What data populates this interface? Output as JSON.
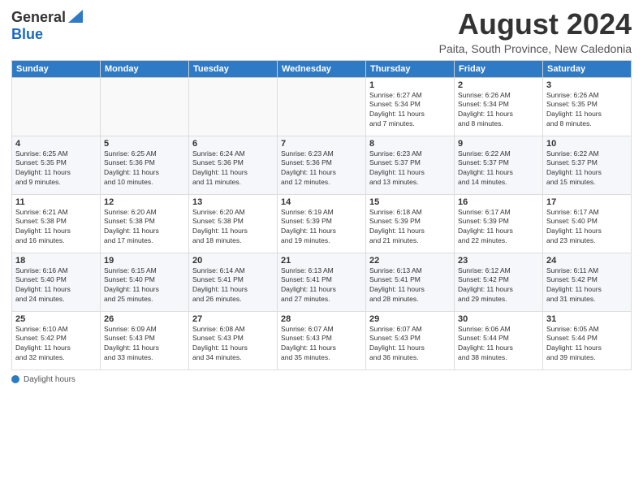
{
  "logo": {
    "general": "General",
    "blue": "Blue"
  },
  "title": "August 2024",
  "subtitle": "Paita, South Province, New Caledonia",
  "headers": [
    "Sunday",
    "Monday",
    "Tuesday",
    "Wednesday",
    "Thursday",
    "Friday",
    "Saturday"
  ],
  "weeks": [
    [
      {
        "day": "",
        "info": ""
      },
      {
        "day": "",
        "info": ""
      },
      {
        "day": "",
        "info": ""
      },
      {
        "day": "",
        "info": ""
      },
      {
        "day": "1",
        "info": "Sunrise: 6:27 AM\nSunset: 5:34 PM\nDaylight: 11 hours\nand 7 minutes."
      },
      {
        "day": "2",
        "info": "Sunrise: 6:26 AM\nSunset: 5:34 PM\nDaylight: 11 hours\nand 8 minutes."
      },
      {
        "day": "3",
        "info": "Sunrise: 6:26 AM\nSunset: 5:35 PM\nDaylight: 11 hours\nand 8 minutes."
      }
    ],
    [
      {
        "day": "4",
        "info": "Sunrise: 6:25 AM\nSunset: 5:35 PM\nDaylight: 11 hours\nand 9 minutes."
      },
      {
        "day": "5",
        "info": "Sunrise: 6:25 AM\nSunset: 5:36 PM\nDaylight: 11 hours\nand 10 minutes."
      },
      {
        "day": "6",
        "info": "Sunrise: 6:24 AM\nSunset: 5:36 PM\nDaylight: 11 hours\nand 11 minutes."
      },
      {
        "day": "7",
        "info": "Sunrise: 6:23 AM\nSunset: 5:36 PM\nDaylight: 11 hours\nand 12 minutes."
      },
      {
        "day": "8",
        "info": "Sunrise: 6:23 AM\nSunset: 5:37 PM\nDaylight: 11 hours\nand 13 minutes."
      },
      {
        "day": "9",
        "info": "Sunrise: 6:22 AM\nSunset: 5:37 PM\nDaylight: 11 hours\nand 14 minutes."
      },
      {
        "day": "10",
        "info": "Sunrise: 6:22 AM\nSunset: 5:37 PM\nDaylight: 11 hours\nand 15 minutes."
      }
    ],
    [
      {
        "day": "11",
        "info": "Sunrise: 6:21 AM\nSunset: 5:38 PM\nDaylight: 11 hours\nand 16 minutes."
      },
      {
        "day": "12",
        "info": "Sunrise: 6:20 AM\nSunset: 5:38 PM\nDaylight: 11 hours\nand 17 minutes."
      },
      {
        "day": "13",
        "info": "Sunrise: 6:20 AM\nSunset: 5:38 PM\nDaylight: 11 hours\nand 18 minutes."
      },
      {
        "day": "14",
        "info": "Sunrise: 6:19 AM\nSunset: 5:39 PM\nDaylight: 11 hours\nand 19 minutes."
      },
      {
        "day": "15",
        "info": "Sunrise: 6:18 AM\nSunset: 5:39 PM\nDaylight: 11 hours\nand 21 minutes."
      },
      {
        "day": "16",
        "info": "Sunrise: 6:17 AM\nSunset: 5:39 PM\nDaylight: 11 hours\nand 22 minutes."
      },
      {
        "day": "17",
        "info": "Sunrise: 6:17 AM\nSunset: 5:40 PM\nDaylight: 11 hours\nand 23 minutes."
      }
    ],
    [
      {
        "day": "18",
        "info": "Sunrise: 6:16 AM\nSunset: 5:40 PM\nDaylight: 11 hours\nand 24 minutes."
      },
      {
        "day": "19",
        "info": "Sunrise: 6:15 AM\nSunset: 5:40 PM\nDaylight: 11 hours\nand 25 minutes."
      },
      {
        "day": "20",
        "info": "Sunrise: 6:14 AM\nSunset: 5:41 PM\nDaylight: 11 hours\nand 26 minutes."
      },
      {
        "day": "21",
        "info": "Sunrise: 6:13 AM\nSunset: 5:41 PM\nDaylight: 11 hours\nand 27 minutes."
      },
      {
        "day": "22",
        "info": "Sunrise: 6:13 AM\nSunset: 5:41 PM\nDaylight: 11 hours\nand 28 minutes."
      },
      {
        "day": "23",
        "info": "Sunrise: 6:12 AM\nSunset: 5:42 PM\nDaylight: 11 hours\nand 29 minutes."
      },
      {
        "day": "24",
        "info": "Sunrise: 6:11 AM\nSunset: 5:42 PM\nDaylight: 11 hours\nand 31 minutes."
      }
    ],
    [
      {
        "day": "25",
        "info": "Sunrise: 6:10 AM\nSunset: 5:42 PM\nDaylight: 11 hours\nand 32 minutes."
      },
      {
        "day": "26",
        "info": "Sunrise: 6:09 AM\nSunset: 5:43 PM\nDaylight: 11 hours\nand 33 minutes."
      },
      {
        "day": "27",
        "info": "Sunrise: 6:08 AM\nSunset: 5:43 PM\nDaylight: 11 hours\nand 34 minutes."
      },
      {
        "day": "28",
        "info": "Sunrise: 6:07 AM\nSunset: 5:43 PM\nDaylight: 11 hours\nand 35 minutes."
      },
      {
        "day": "29",
        "info": "Sunrise: 6:07 AM\nSunset: 5:43 PM\nDaylight: 11 hours\nand 36 minutes."
      },
      {
        "day": "30",
        "info": "Sunrise: 6:06 AM\nSunset: 5:44 PM\nDaylight: 11 hours\nand 38 minutes."
      },
      {
        "day": "31",
        "info": "Sunrise: 6:05 AM\nSunset: 5:44 PM\nDaylight: 11 hours\nand 39 minutes."
      }
    ]
  ],
  "footer": {
    "daylight_label": "Daylight hours"
  }
}
